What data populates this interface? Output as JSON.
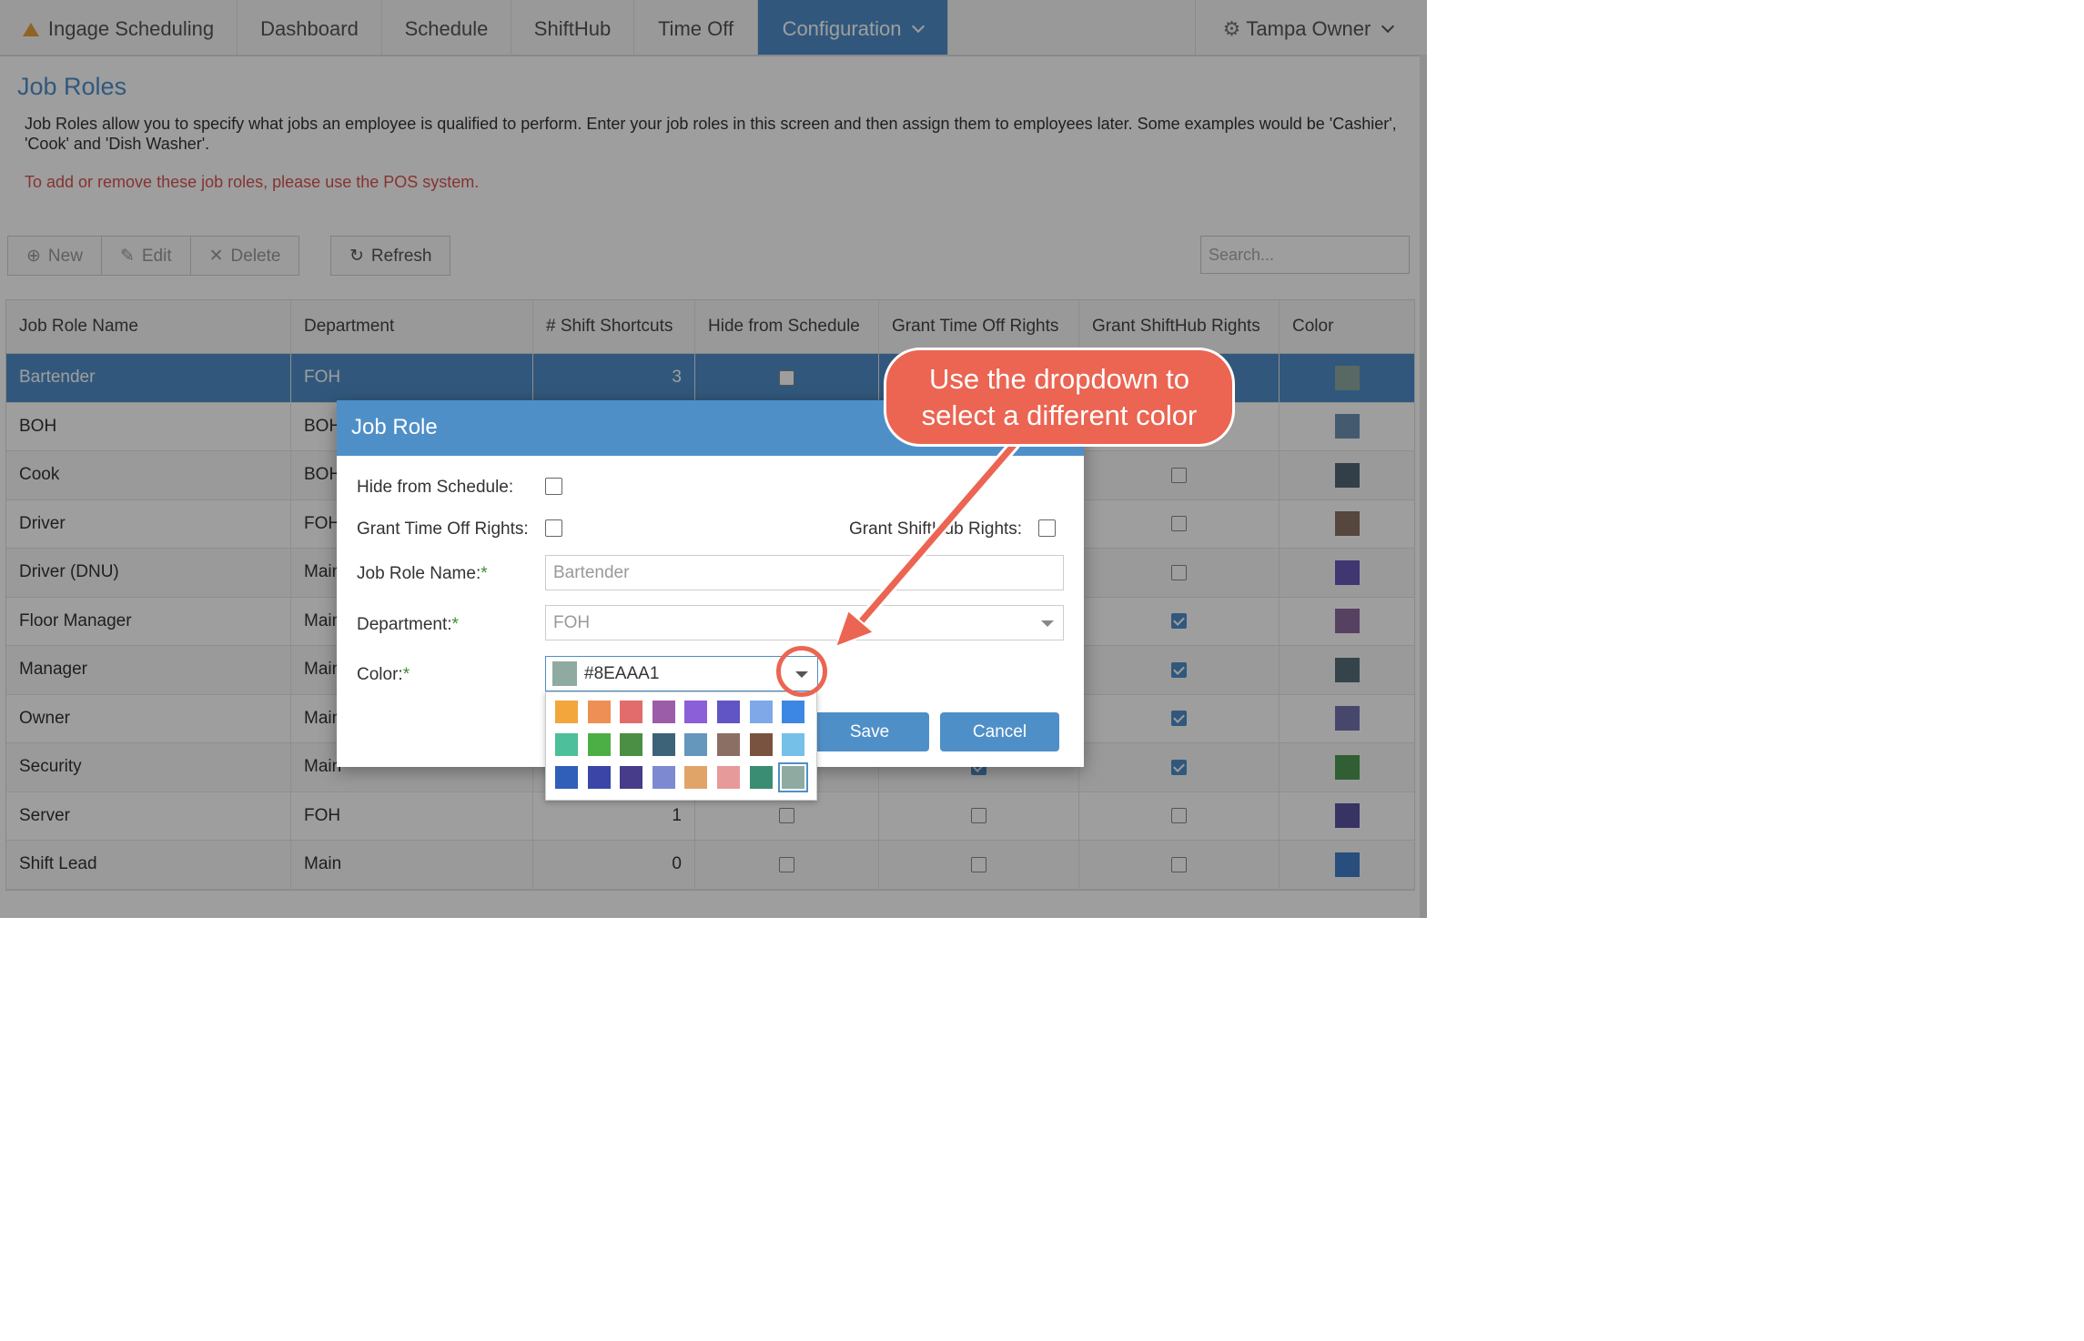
{
  "nav": {
    "brand": "Ingage Scheduling",
    "items": [
      "Dashboard",
      "Schedule",
      "ShiftHub",
      "Time Off"
    ],
    "active": "Configuration",
    "user": "Tampa Owner"
  },
  "page": {
    "title": "Job Roles",
    "description": "Job Roles allow you to specify what jobs an employee is qualified to perform. Enter your job roles in this screen and then assign them to employees later. Some examples would be 'Cashier', 'Cook' and 'Dish Washer'.",
    "warning": "To add or remove these job roles, please use the POS system."
  },
  "toolbar": {
    "new": "New",
    "edit": "Edit",
    "delete": "Delete",
    "refresh": "Refresh",
    "search_placeholder": "Search..."
  },
  "grid": {
    "columns": [
      "Job Role Name",
      "Department",
      "# Shift Shortcuts",
      "Hide from Schedule",
      "Grant Time Off Rights",
      "Grant ShiftHub Rights",
      "Color"
    ],
    "rows": [
      {
        "name": "Bartender",
        "dept": "FOH",
        "shortcuts": "3",
        "hide": false,
        "timeoff": false,
        "shifthub": false,
        "color": "#8EAAA1"
      },
      {
        "name": "BOH",
        "dept": "BOH",
        "shortcuts": "",
        "hide": false,
        "timeoff": false,
        "shifthub": false,
        "color": "#6f93b3"
      },
      {
        "name": "Cook",
        "dept": "BOH",
        "shortcuts": "",
        "hide": false,
        "timeoff": false,
        "shifthub": false,
        "color": "#516777"
      },
      {
        "name": "Driver",
        "dept": "FOH",
        "shortcuts": "",
        "hide": false,
        "timeoff": false,
        "shifthub": false,
        "color": "#8a7165"
      },
      {
        "name": "Driver (DNU)",
        "dept": "Main",
        "shortcuts": "",
        "hide": false,
        "timeoff": false,
        "shifthub": false,
        "color": "#6858b8"
      },
      {
        "name": "Floor Manager",
        "dept": "Main",
        "shortcuts": "",
        "hide": false,
        "timeoff": false,
        "shifthub": true,
        "color": "#8d6aa0"
      },
      {
        "name": "Manager",
        "dept": "Main",
        "shortcuts": "",
        "hide": false,
        "timeoff": false,
        "shifthub": true,
        "color": "#566e78"
      },
      {
        "name": "Owner",
        "dept": "Main",
        "shortcuts": "",
        "hide": false,
        "timeoff": false,
        "shifthub": true,
        "color": "#7373b0"
      },
      {
        "name": "Security",
        "dept": "Main",
        "shortcuts": "",
        "hide": false,
        "timeoff": true,
        "shifthub": true,
        "color": "#4f9a53"
      },
      {
        "name": "Server",
        "dept": "FOH",
        "shortcuts": "1",
        "hide": false,
        "timeoff": false,
        "shifthub": false,
        "color": "#5a55a0"
      },
      {
        "name": "Shift Lead",
        "dept": "Main",
        "shortcuts": "0",
        "hide": false,
        "timeoff": false,
        "shifthub": false,
        "color": "#3f7fc8"
      }
    ]
  },
  "dialog": {
    "title": "Job Role",
    "hide_label": "Hide from Schedule:",
    "timeoff_label": "Grant Time Off Rights:",
    "shifthub_label": "Grant ShiftHub Rights:",
    "name_label": "Job Role Name:",
    "name_placeholder": "Bartender",
    "dept_label": "Department:",
    "dept_value": "FOH",
    "color_label": "Color:",
    "required_mark": "*",
    "color_value": "#8EAAA1",
    "save": "Save",
    "cancel": "Cancel"
  },
  "palette": [
    "#f2a63c",
    "#ee8f55",
    "#e26c6c",
    "#9b5da8",
    "#8a5fd8",
    "#6154c4",
    "#7fa8e8",
    "#3d87e4",
    "#4dbf9a",
    "#4caf46",
    "#4b8f45",
    "#3d6378",
    "#6596bb",
    "#8b6f65",
    "#7a5240",
    "#74c0e8",
    "#2f5fb8",
    "#3b45a8",
    "#463c8a",
    "#7d8ad2",
    "#e0a468",
    "#e79a9a",
    "#3a8c72",
    "#8EAAA1"
  ],
  "annotation": {
    "line1": "Use the dropdown to",
    "line2": "select a different color"
  }
}
